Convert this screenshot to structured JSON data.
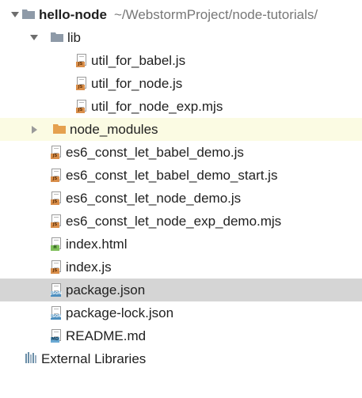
{
  "root": {
    "name": "hello-node",
    "path": "~/WebstormProject/node-tutorials/"
  },
  "lib": {
    "name": "lib",
    "files": [
      "util_for_babel.js",
      "util_for_node.js",
      "util_for_node_exp.mjs"
    ]
  },
  "node_modules": {
    "name": "node_modules"
  },
  "files": [
    "es6_const_let_babel_demo.js",
    "es6_const_let_babel_demo_start.js",
    "es6_const_let_node_demo.js",
    "es6_const_let_node_exp_demo.mjs",
    "index.html",
    "index.js",
    "package.json",
    "package-lock.json",
    "README.md"
  ],
  "icon_tags": {
    "js": "JS",
    "html": "H",
    "json": "JSON",
    "md": "MD"
  },
  "external_libraries": "External Libraries",
  "colors": {
    "folder": "#8e9aa8",
    "excluded_folder": "#e5a14f",
    "selected_row": "#d5d5d5",
    "excluded_row": "#fbfbe3",
    "path": "#777777"
  }
}
